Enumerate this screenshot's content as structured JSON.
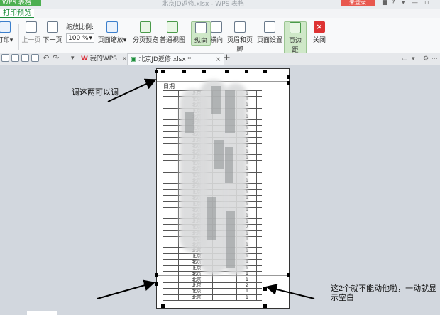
{
  "window": {
    "app_button": "WPS 表格",
    "title": "北京JD返修.xlsx - WPS 表格",
    "login_button": "未登录"
  },
  "ribbon": {
    "active_tab": "打印预览",
    "print_label": "打印",
    "prev_page": "上一页",
    "next_page": "下一页",
    "zoom_label": "缩放比例:",
    "zoom_value": "100 %",
    "page_zoom": "页面缩放",
    "page_break_preview": "分页预览",
    "normal_view": "普通视图",
    "portrait": "纵向",
    "landscape": "横向",
    "header_footer": "页眉和页脚",
    "page_setup": "页面设置",
    "margins": "页边距",
    "close": "关闭"
  },
  "tabs": [
    {
      "label": "我的WPS",
      "icon": "wps-logo-icon"
    },
    {
      "label": "北京JD返修.xlsx *",
      "icon": "spreadsheet-icon"
    }
  ],
  "sheet": {
    "header_cell": "日期",
    "rows": [
      {
        "c1": "北京",
        "c3": "1"
      },
      {
        "c1": "北京",
        "c3": "1"
      },
      {
        "c1": "北京",
        "c3": "1"
      },
      {
        "c1": "北京",
        "c3": "1"
      },
      {
        "c1": "北京",
        "c3": "1"
      },
      {
        "c1": "北京",
        "c3": "1"
      },
      {
        "c1": "北京",
        "c3": "1"
      },
      {
        "c1": "北京",
        "c3": "2"
      },
      {
        "c1": "北京",
        "c3": "1"
      },
      {
        "c1": "北京",
        "c3": "1"
      },
      {
        "c1": "北京",
        "c3": "1"
      },
      {
        "c1": "北京",
        "c3": "1"
      },
      {
        "c1": "北京",
        "c3": "1"
      },
      {
        "c1": "北京",
        "c3": "1"
      },
      {
        "c1": "北京",
        "c3": "1"
      },
      {
        "c1": "北京",
        "c3": "1"
      },
      {
        "c1": "北京",
        "c3": "1"
      },
      {
        "c1": "北京",
        "c3": "1"
      },
      {
        "c1": "北京",
        "c3": "1"
      },
      {
        "c1": "北京",
        "c3": "1"
      },
      {
        "c1": "北京",
        "c3": "1"
      },
      {
        "c1": "北京",
        "c3": "1"
      },
      {
        "c1": "北京",
        "c3": "1"
      },
      {
        "c1": "北京",
        "c3": "2"
      },
      {
        "c1": "北京",
        "c3": "1"
      },
      {
        "c1": "北京",
        "c3": "1"
      },
      {
        "c1": "北京",
        "c3": "1"
      },
      {
        "c1": "北京",
        "c3": "1"
      },
      {
        "c1": "北京",
        "c3": "1"
      },
      {
        "c1": "北京",
        "c3": "1"
      },
      {
        "c1": "北京",
        "c3": "1"
      },
      {
        "c1": "北京",
        "c3": "1"
      },
      {
        "c1": "北京",
        "c3": "1"
      },
      {
        "c1": "北京",
        "c3": "2"
      },
      {
        "c1": "北京",
        "c3": "1"
      },
      {
        "c1": "北京",
        "c3": "1"
      }
    ]
  },
  "annotations": {
    "top_note": "调这两可以调",
    "bottom_note_1": "这2个就不能动他啦，一动就显",
    "bottom_note_2": "示空白"
  }
}
